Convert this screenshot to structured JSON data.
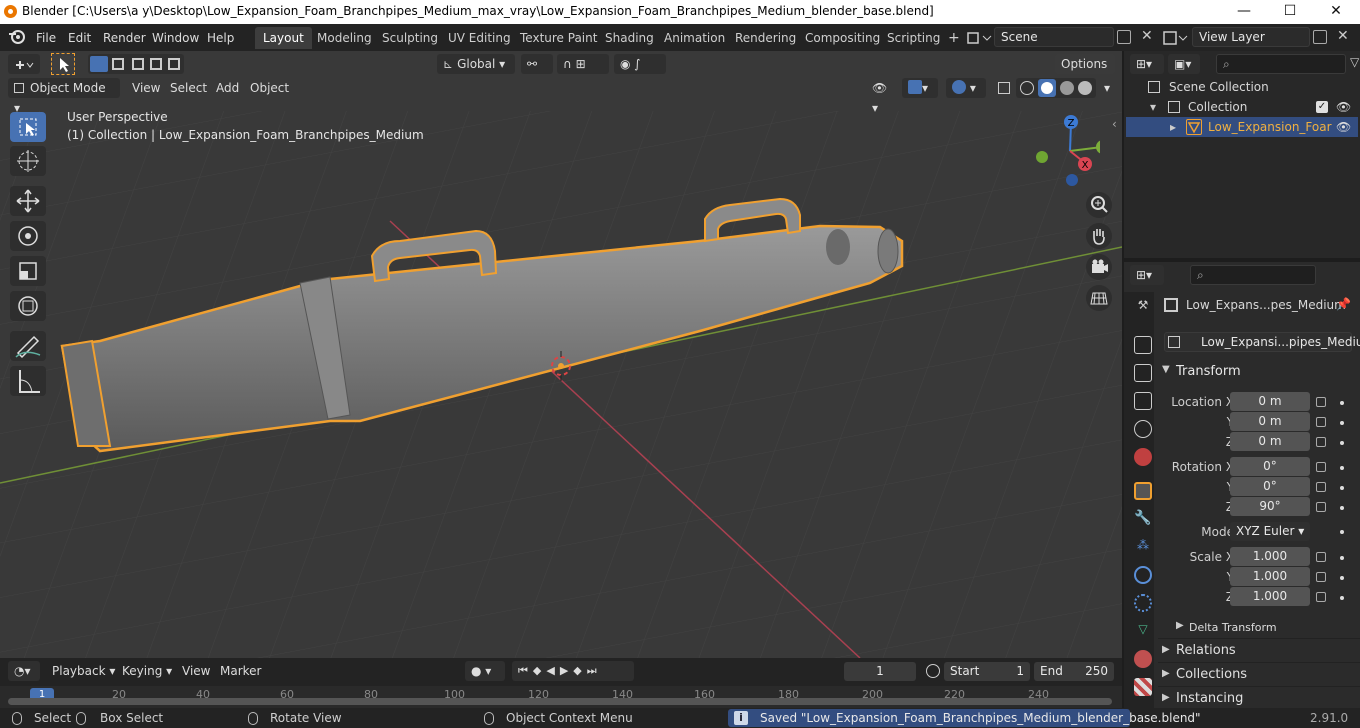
{
  "window": {
    "title": "Blender [C:\\Users\\a y\\Desktop\\Low_Expansion_Foam_Branchpipes_Medium_max_vray\\Low_Expansion_Foam_Branchpipes_Medium_blender_base.blend]"
  },
  "menu": [
    "File",
    "Edit",
    "Render",
    "Window",
    "Help"
  ],
  "workspaces": [
    "Layout",
    "Modeling",
    "Sculpting",
    "UV Editing",
    "Texture Paint",
    "Shading",
    "Animation",
    "Rendering",
    "Compositing",
    "Scripting"
  ],
  "scene": "Scene",
  "view_layer": "View Layer",
  "header": {
    "orientation": "Global",
    "options": "Options"
  },
  "viewport_menu": {
    "mode": "Object Mode",
    "view": "View",
    "select": "Select",
    "add": "Add",
    "object": "Object"
  },
  "overlay": {
    "perspective": "User Perspective",
    "collection": "(1) Collection | Low_Expansion_Foam_Branchpipes_Medium"
  },
  "gizmo": {
    "z": "Z",
    "y": "Y",
    "x": "X"
  },
  "outliner": {
    "scene_collection": "Scene Collection",
    "collection": "Collection",
    "object": "Low_Expansion_Foar"
  },
  "properties": {
    "object_name": "Low_Expans...pes_Medium",
    "datablock": "Low_Expansi...pipes_Medium",
    "transform": "Transform",
    "location_x_label": "Location X",
    "y_label": "Y",
    "z_label": "Z",
    "rotation_x_label": "Rotation X",
    "scale_x_label": "Scale X",
    "location": [
      "0 m",
      "0 m",
      "0 m"
    ],
    "rotation": [
      "0°",
      "0°",
      "90°"
    ],
    "mode_label": "Mode",
    "mode": "XYZ Euler",
    "scale": [
      "1.000",
      "1.000",
      "1.000"
    ],
    "delta": "Delta Transform",
    "relations": "Relations",
    "collections": "Collections",
    "instancing": "Instancing"
  },
  "timeline": {
    "playback": "Playback",
    "keying": "Keying",
    "view": "View",
    "marker": "Marker",
    "current_frame": "1",
    "start_label": "Start",
    "start": "1",
    "end_label": "End",
    "end": "250",
    "ruler": [
      "1",
      "20",
      "40",
      "60",
      "80",
      "100",
      "120",
      "140",
      "160",
      "180",
      "200",
      "220",
      "240"
    ]
  },
  "status": {
    "select": "Select",
    "box_select": "Box Select",
    "rotate": "Rotate View",
    "context": "Object Context Menu",
    "saved": "Saved \"Low_Expansion_Foam_Branchpipes_Medium_blender_base.blend\"",
    "version": "2.91.0"
  },
  "colors": {
    "accent": "#4772b3",
    "selection_outline": "#f0a030",
    "x_axis": "#d94552",
    "y_axis": "#7cad3a",
    "z_axis": "#3c7ad4"
  }
}
